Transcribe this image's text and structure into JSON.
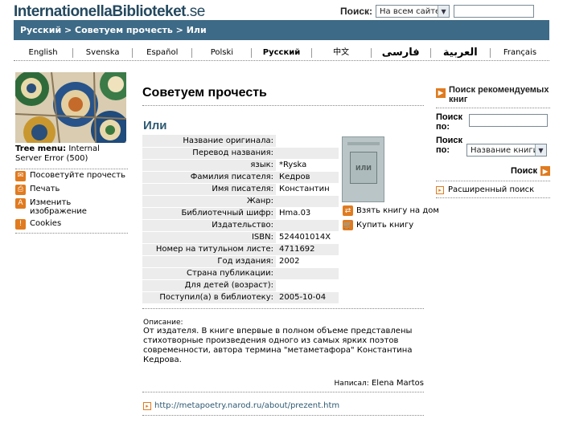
{
  "header": {
    "logo_part1": "Internationella",
    "logo_part2": "Biblioteket",
    "logo_part3": ".se",
    "search_label": "Поиск:",
    "search_scope": "На всем сайте"
  },
  "breadcrumb": {
    "items": [
      "Русский",
      "Советуем прочесть",
      "Или"
    ],
    "separator": " > "
  },
  "languages": [
    {
      "label": "English"
    },
    {
      "label": "Svenska"
    },
    {
      "label": "Español"
    },
    {
      "label": "Polski"
    },
    {
      "label": "Русский",
      "current": true
    },
    {
      "label": "中文"
    },
    {
      "label": "فارسی"
    },
    {
      "label": "العربية"
    },
    {
      "label": "Français"
    }
  ],
  "left": {
    "tree_label": "Tree menu:",
    "tree_text": " Internal Server Error (500)",
    "menu": [
      {
        "label": "Посоветуйте прочесть",
        "icon": "envelope-icon"
      },
      {
        "label": "Печать",
        "icon": "print-icon"
      },
      {
        "label": "Изменить изображение",
        "icon": "text-size-icon"
      },
      {
        "label": "Cookies",
        "icon": "info-icon"
      }
    ]
  },
  "main": {
    "heading": "Советуем прочесть",
    "book_title": "Или",
    "fields": [
      {
        "key": "Название оригинала:",
        "value": ""
      },
      {
        "key": "Перевод названия:",
        "value": ""
      },
      {
        "key": "язык:",
        "value": "*Ryska"
      },
      {
        "key": "Фамилия писателя:",
        "value": "Кедров"
      },
      {
        "key": "Имя писателя:",
        "value": "Константин"
      },
      {
        "key": "Жанр:",
        "value": ""
      },
      {
        "key": "Библиотечный шифр:",
        "value": "Hma.03"
      },
      {
        "key": "Издательство:",
        "value": ""
      },
      {
        "key": "ISBN:",
        "value": "524401014X"
      },
      {
        "key": "Номер на титульном листе:",
        "value": "4711692"
      },
      {
        "key": "Год издания:",
        "value": "2002"
      },
      {
        "key": "Страна публикации:",
        "value": ""
      },
      {
        "key": "Для детей (возраст):",
        "value": ""
      },
      {
        "key": "Поступил(а) в библиотеку:",
        "value": "2005-10-04"
      }
    ],
    "cover_text": "ИЛИ",
    "actions": {
      "borrow": "Взять книгу на дом",
      "buy": "Купить книгу"
    },
    "description_label": "Описание:",
    "description": "От издателя. В книге впервые в полном объеме представлены стихотворные произведения одного из самых ярких поэтов современности, автора термина \"метаметафора\" Константина Кедрова.",
    "author_label": "Написал:",
    "author": "Elena Martos",
    "link": "http://metapoetry.narod.ru/about/prezent.htm"
  },
  "right": {
    "title": "Поиск рекомендуемых книг",
    "search_label": "Поиск по:",
    "search_by_label": "Поиск по:",
    "search_by_value": "Название книги",
    "search_button": "Поиск",
    "advanced": "Расширенный поиск"
  },
  "colors": {
    "navbar": "#3d6a86",
    "accent": "#e07b1f",
    "title_blue": "#2e5a73"
  }
}
